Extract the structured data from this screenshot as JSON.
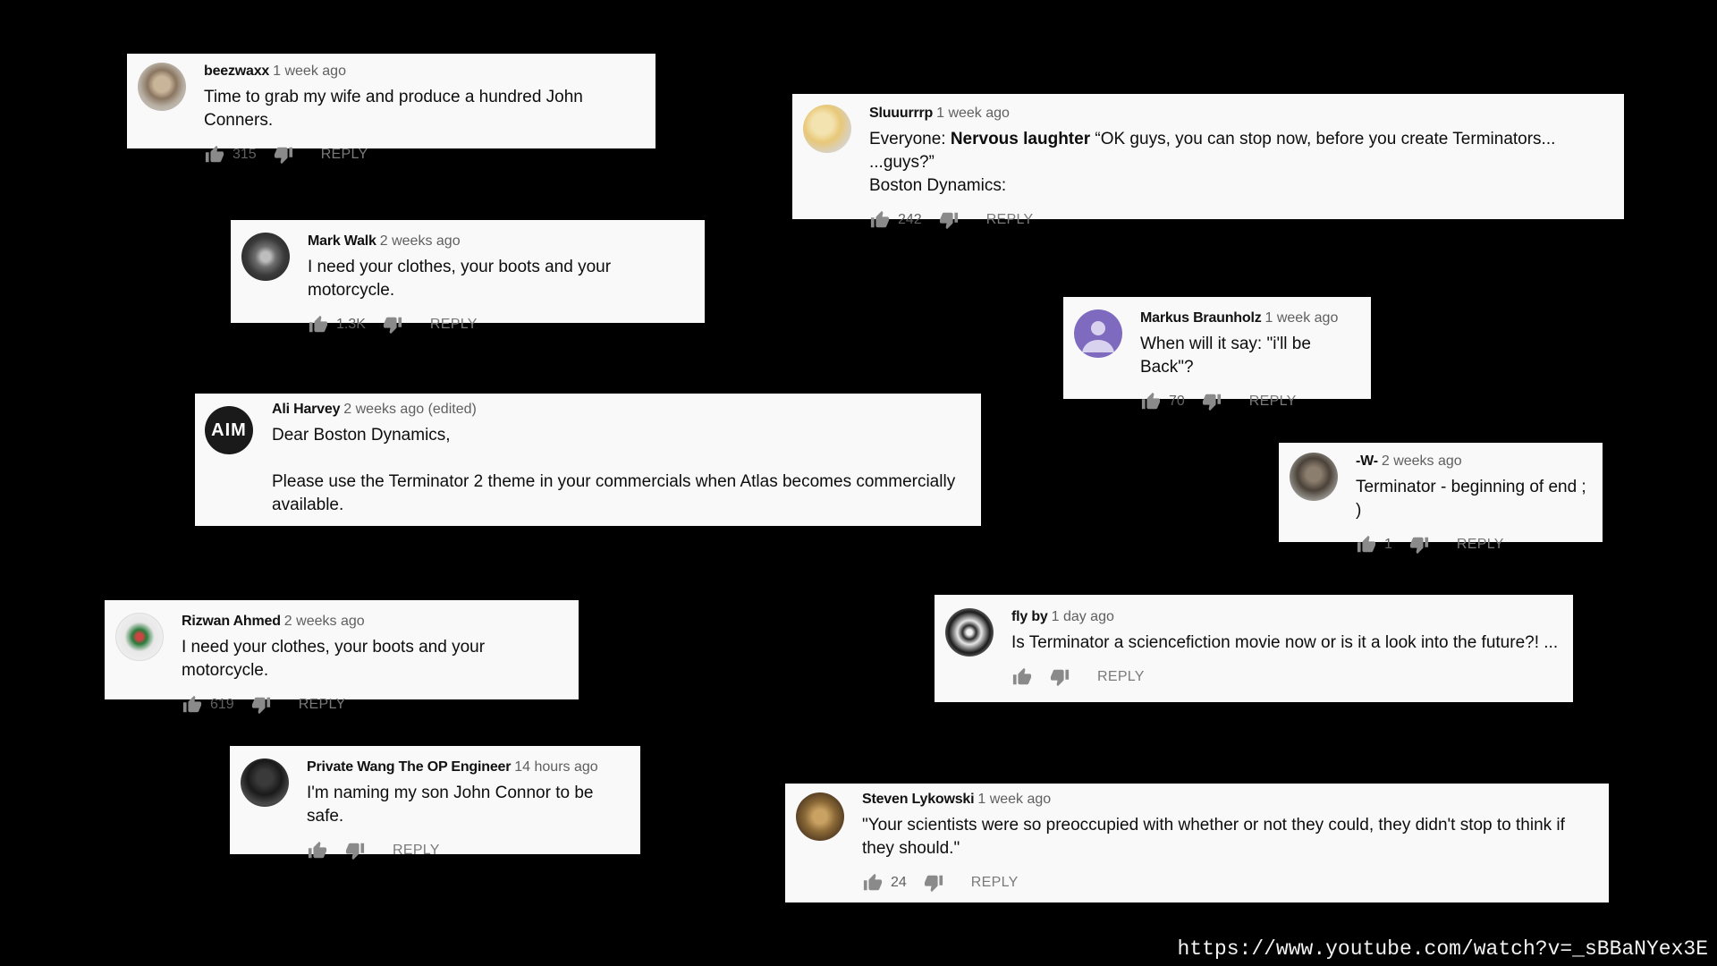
{
  "comments": [
    {
      "author": "beezwaxx",
      "time": "1 week ago",
      "text": "Time to grab my wife and produce a hundred John Conners.",
      "likes": "315",
      "reply": "REPLY"
    },
    {
      "author": "Sluuurrrp",
      "time": "1 week ago",
      "text_prefix": "Everyone: ",
      "text_bold": "Nervous laughter",
      "text_suffix": " “OK guys, you can stop now, before you create Terminators...   ...guys?”\nBoston Dynamics:",
      "likes": "242",
      "reply": "REPLY"
    },
    {
      "author": "Mark Walk",
      "time": "2 weeks ago",
      "text": "I need your clothes, your boots and your motorcycle.",
      "likes": "1.3K",
      "reply": "REPLY"
    },
    {
      "author": "Markus Braunholz",
      "time": "1 week ago",
      "text": "When will it say: \"i'll be Back\"?",
      "likes": "70",
      "reply": "REPLY"
    },
    {
      "author": "Ali Harvey",
      "time": "2 weeks ago (edited)",
      "text": "Dear Boston Dynamics,\n\nPlease use the Terminator 2 theme in your commercials when Atlas becomes commercially available.",
      "avatar_text": "AIM"
    },
    {
      "author": "-W-",
      "time": "2 weeks ago",
      "text": "Terminator - beginning of end ; )",
      "likes": "1",
      "reply": "REPLY"
    },
    {
      "author": "Rizwan Ahmed",
      "time": "2 weeks ago",
      "text": "I need your clothes, your boots and your motorcycle.",
      "likes": "619",
      "reply": "REPLY"
    },
    {
      "author": "fly by",
      "time": "1 day ago",
      "text": "Is Terminator a sciencefiction movie now or is it a look into the future?! ...",
      "likes": "",
      "reply": "REPLY"
    },
    {
      "author": "Private Wang The OP Engineer",
      "time": "14 hours ago",
      "text": "I'm naming my son John Connor to be safe.",
      "likes": "",
      "reply": "REPLY"
    },
    {
      "author": "Steven Lykowski",
      "time": "1 week ago",
      "text": "\"Your scientists were so preoccupied with whether or not they could, they didn't stop to think if they should.\"",
      "likes": "24",
      "reply": "REPLY"
    }
  ],
  "url": "https://www.youtube.com/watch?v=_sBBaNYex3E",
  "colors": {
    "background": "#000000",
    "card": "#f9f9f9",
    "meta": "#606060"
  },
  "icons": [
    "thumb-up-icon",
    "thumb-down-icon"
  ]
}
